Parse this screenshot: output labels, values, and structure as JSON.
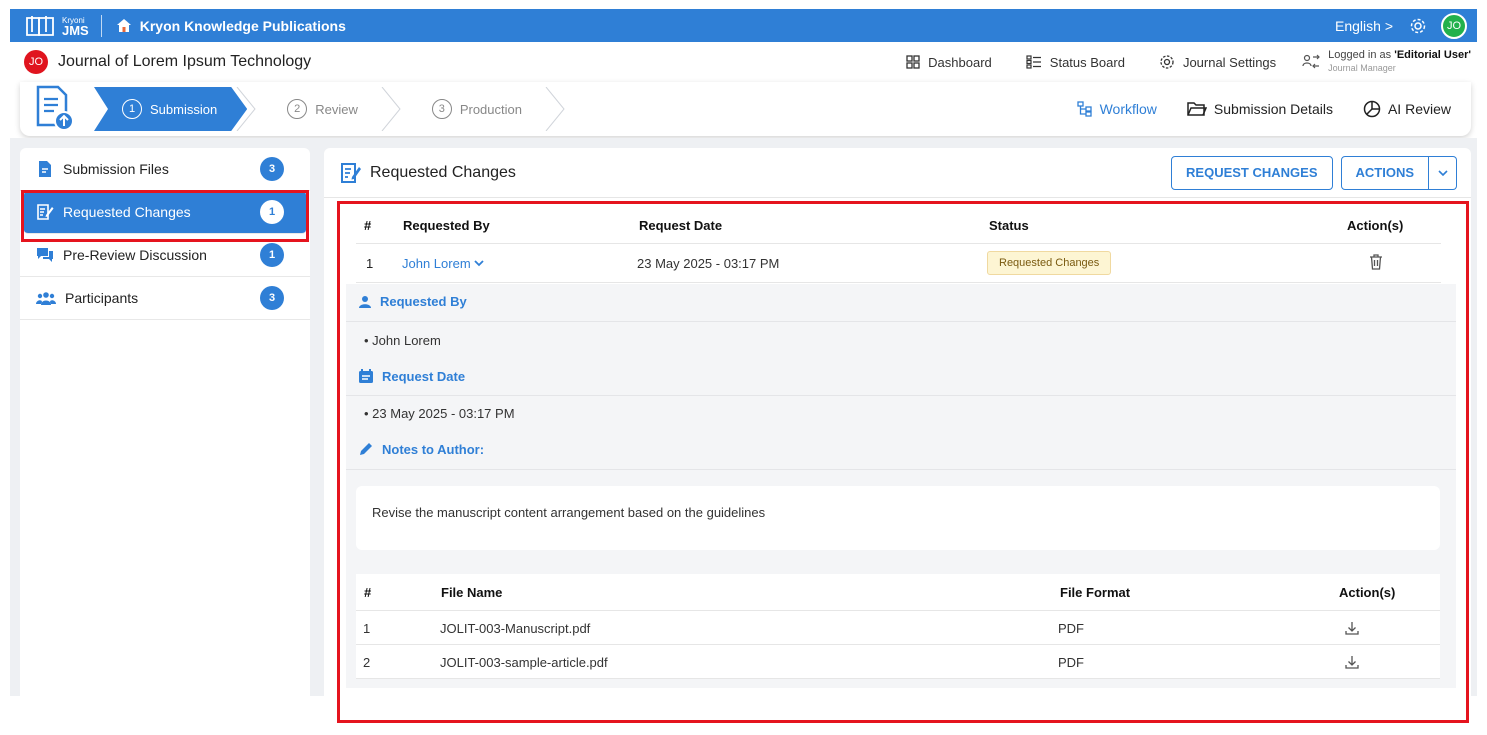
{
  "app": {
    "brand_small": "Kryoni",
    "brand_big": "JMS",
    "publisher": "Kryon Knowledge Publications",
    "language": "English >",
    "user_initials": "JO"
  },
  "journal": {
    "initials": "JO",
    "title": "Journal of Lorem Ipsum Technology",
    "nav": [
      {
        "label": "Dashboard",
        "icon": "dashboard-icon"
      },
      {
        "label": "Status Board",
        "icon": "status-board-icon"
      },
      {
        "label": "Journal Settings",
        "icon": "settings-icon"
      }
    ],
    "logged_prefix": "Logged in as ",
    "logged_user": "'Editorial User'",
    "logged_role": "Journal Manager"
  },
  "workflow": {
    "steps": [
      {
        "num": "1",
        "label": "Submission",
        "active": true
      },
      {
        "num": "2",
        "label": "Review",
        "active": false
      },
      {
        "num": "3",
        "label": "Production",
        "active": false
      }
    ],
    "links": [
      {
        "label": "Workflow",
        "icon": "workflow-icon"
      },
      {
        "label": "Submission Details",
        "icon": "folder-icon"
      },
      {
        "label": "AI Review",
        "icon": "pie-icon"
      }
    ]
  },
  "sidebar": {
    "items": [
      {
        "label": "Submission Files",
        "count": "3"
      },
      {
        "label": "Requested Changes",
        "count": "1",
        "active": true
      },
      {
        "label": "Pre-Review Discussion",
        "count": "1"
      },
      {
        "label": "Participants",
        "count": "3"
      }
    ]
  },
  "main": {
    "title": "Requested Changes",
    "request_changes_btn": "REQUEST CHANGES",
    "actions_btn": "ACTIONS",
    "table": {
      "headers": [
        "#",
        "Requested By",
        "Request Date",
        "Status",
        "Action(s)"
      ],
      "row": {
        "num": "1",
        "by": "John Lorem",
        "date": "23 May 2025 - 03:17 PM",
        "status": "Requested Changes"
      }
    },
    "detail": {
      "requested_by_label": "Requested By",
      "requested_by_value": "• John Lorem",
      "request_date_label": "Request Date",
      "request_date_value": "• 23 May 2025 - 03:17 PM",
      "notes_label": "Notes to Author:",
      "notes_text": "Revise the manuscript content arrangement based on the guidelines"
    },
    "files": {
      "headers": [
        "#",
        "File Name",
        "File Format",
        "Action(s)"
      ],
      "rows": [
        {
          "num": "1",
          "name": "JOLIT-003-Manuscript.pdf",
          "format": "PDF"
        },
        {
          "num": "2",
          "name": "JOLIT-003-sample-article.pdf",
          "format": "PDF"
        }
      ]
    }
  },
  "colors": {
    "primary": "#2f7fd6",
    "highlight": "#e5141e",
    "status_bg": "#fdf5d3"
  }
}
